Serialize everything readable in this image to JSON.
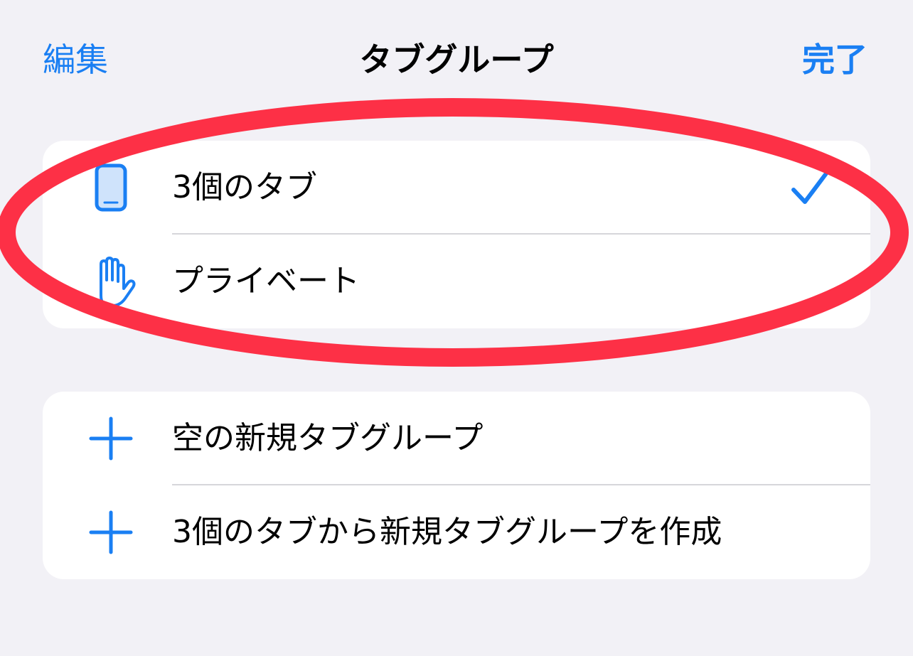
{
  "colors": {
    "accent": "#1a7ff3",
    "highlight_ring": "#fd3046",
    "background": "#f2f1f6"
  },
  "nav": {
    "edit_label": "編集",
    "title": "タブグループ",
    "done_label": "完了"
  },
  "tab_groups": {
    "items": [
      {
        "label": "3個のタブ",
        "icon": "iphone-icon",
        "selected": true
      },
      {
        "label": "プライベート",
        "icon": "hand-raised-icon",
        "selected": false
      }
    ]
  },
  "actions": {
    "items": [
      {
        "label": "空の新規タブグループ",
        "icon": "plus-icon"
      },
      {
        "label": "3個のタブから新規タブグループを作成",
        "icon": "plus-icon"
      }
    ]
  }
}
